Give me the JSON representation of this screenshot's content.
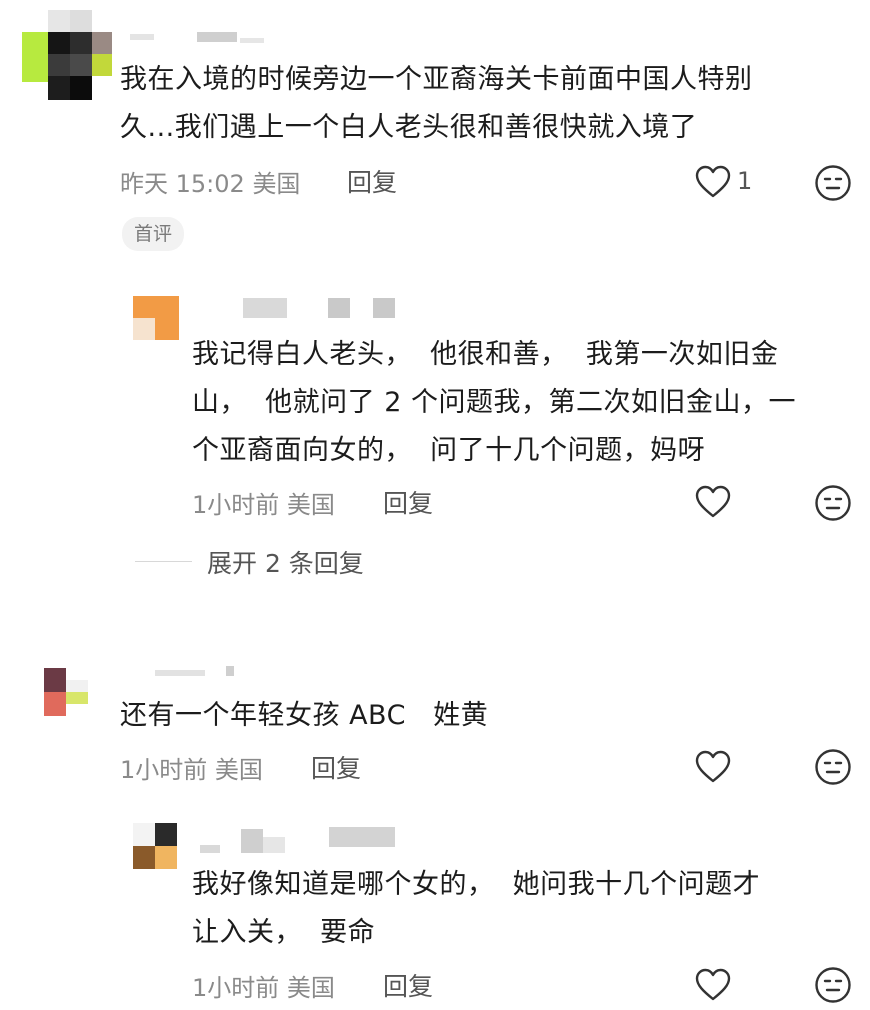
{
  "comments": [
    {
      "text": "我在入境的时候旁边一个亚裔海关卡前面中国人特别久...我们遇上一个白人老头很和善很快就入境了",
      "line1": "我在入境的时候旁边一个亚裔海关卡前面中国人特别",
      "line2": "久...我们遇上一个白人老头很和善很快就入境了",
      "time": "昨天 15:02",
      "location": "美国",
      "reply_label": "回复",
      "like_count": "1",
      "tag": "首评"
    },
    {
      "line1": "我记得白人老头，  他很和善，  我第一次如旧金",
      "line2": "山，  他就问了 2 个问题我，第二次如旧金山，一",
      "line3": "个亚裔面向女的，  问了十几个问题，妈呀",
      "time": "1小时前",
      "location": "美国",
      "reply_label": "回复",
      "expand_label": "展开 2 条回复"
    },
    {
      "line1": "还有一个年轻女孩 ABC   姓黄",
      "time": "1小时前",
      "location": "美国",
      "reply_label": "回复"
    },
    {
      "line1": "我好像知道是哪个女的，  她问我十几个问题才",
      "line2": "让入关，  要命",
      "time": "1小时前",
      "location": "美国",
      "reply_label": "回复"
    }
  ]
}
